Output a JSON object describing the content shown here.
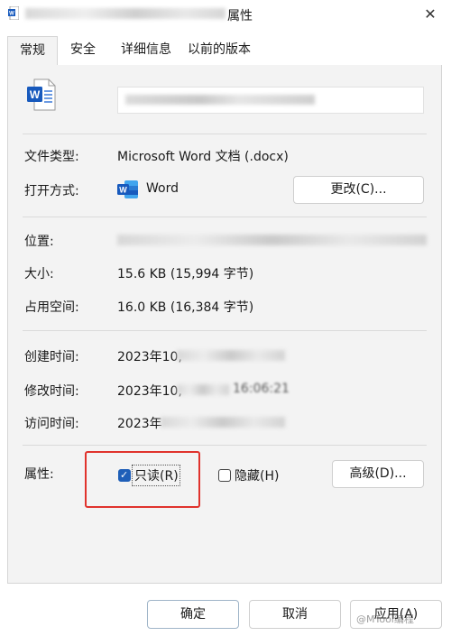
{
  "window": {
    "title_suffix": "属性",
    "close_glyph": "✕"
  },
  "tabs": [
    {
      "label": "常规",
      "active": true
    },
    {
      "label": "安全",
      "active": false
    },
    {
      "label": "详细信息",
      "active": false
    },
    {
      "label": "以前的版本",
      "active": false
    }
  ],
  "general": {
    "file_type_label": "文件类型:",
    "file_type_value": "Microsoft Word 文档 (.docx)",
    "opens_with_label": "打开方式:",
    "opens_with_value": "Word",
    "change_button": "更改(C)...",
    "location_label": "位置:",
    "size_label": "大小:",
    "size_value": "15.6 KB (15,994 字节)",
    "size_on_disk_label": "占用空间:",
    "size_on_disk_value": "16.0 KB (16,384 字节)",
    "created_label": "创建时间:",
    "created_value": "2023年10,",
    "modified_label": "修改时间:",
    "modified_value": "2023年10,",
    "modified_value_tail": "16:06:21",
    "accessed_label": "访问时间:",
    "accessed_value": "2023年",
    "attributes_label": "属性:",
    "readonly_label": "只读(R)",
    "readonly_checked": true,
    "hidden_label": "隐藏(H)",
    "hidden_checked": false,
    "advanced_button": "高级(D)..."
  },
  "footer": {
    "ok_button": "确定",
    "cancel_button": "取消",
    "apply_button": "应用(A)"
  },
  "watermark": "@MTool编程",
  "colors": {
    "word_blue": "#185abd",
    "checkbox_blue": "#1f5fb8",
    "highlight_red": "#e0322c"
  }
}
